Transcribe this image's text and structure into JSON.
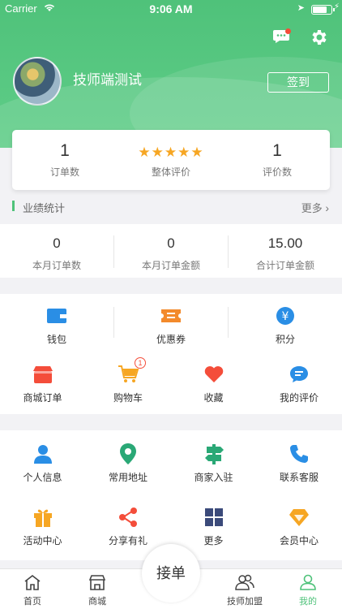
{
  "status_bar": {
    "carrier": "Carrier",
    "time": "9:06 AM"
  },
  "profile": {
    "name": "技师端测试",
    "signin_label": "签到"
  },
  "stats": {
    "orders": {
      "value": "1",
      "label": "订单数"
    },
    "rating": {
      "stars": 5,
      "label": "整体评价"
    },
    "reviews": {
      "value": "1",
      "label": "评价数"
    }
  },
  "performance": {
    "title": "业绩统计",
    "more": "更多",
    "items": [
      {
        "value": "0",
        "label": "本月订单数"
      },
      {
        "value": "0",
        "label": "本月订单金额"
      },
      {
        "value": "15.00",
        "label": "合计订单金额"
      }
    ]
  },
  "assets": [
    {
      "label": "钱包",
      "icon": "wallet-icon"
    },
    {
      "label": "优惠券",
      "icon": "coupon-icon"
    },
    {
      "label": "积分",
      "icon": "points-icon"
    }
  ],
  "shop_row": [
    {
      "label": "商城订单",
      "icon": "shop-order-icon"
    },
    {
      "label": "购物车",
      "icon": "cart-icon",
      "badge": "1"
    },
    {
      "label": "收藏",
      "icon": "heart-icon"
    },
    {
      "label": "我的评价",
      "icon": "comment-icon"
    }
  ],
  "services_row1": [
    {
      "label": "个人信息",
      "icon": "person-icon"
    },
    {
      "label": "常用地址",
      "icon": "location-icon"
    },
    {
      "label": "商家入驻",
      "icon": "signpost-icon"
    },
    {
      "label": "联系客服",
      "icon": "phone-icon"
    }
  ],
  "services_row2": [
    {
      "label": "活动中心",
      "icon": "gift-icon"
    },
    {
      "label": "分享有礼",
      "icon": "share-icon"
    },
    {
      "label": "更多",
      "icon": "grid-icon"
    },
    {
      "label": "会员中心",
      "icon": "diamond-icon"
    }
  ],
  "tabbar": {
    "home": "首页",
    "mall": "商城",
    "center": "接单",
    "join": "技师加盟",
    "mine": "我的"
  },
  "colors": {
    "accent": "#4fc27a",
    "orange": "#f6a623",
    "blue": "#2a8ee5",
    "red": "#f44d3a",
    "navy": "#3b4a7a"
  }
}
